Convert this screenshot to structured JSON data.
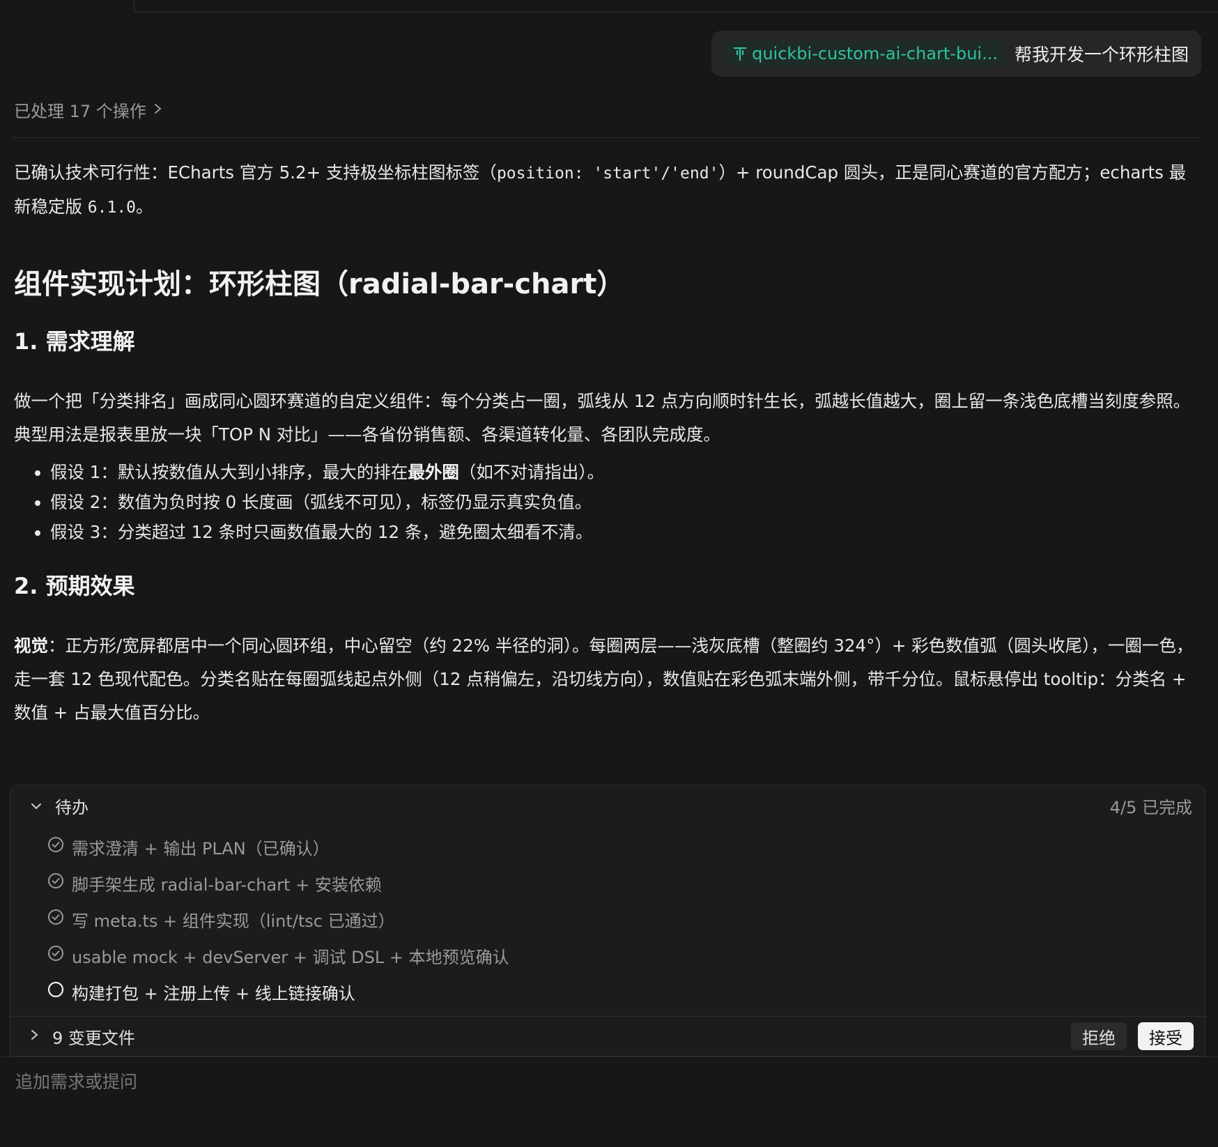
{
  "user_message": {
    "skill_chip": "quickbi-custom-ai-chart-bui...",
    "text": "帮我开发一个环形柱图"
  },
  "processed": {
    "label": "已处理 17 个操作"
  },
  "intro": {
    "part1": "已确认技术可行性：ECharts 官方 5.2+ 支持极坐标柱图标签（",
    "code1": "position: 'start'/'end'",
    "part2": "）+ roundCap 圆头，正是同心赛道的官方配方；echarts 最新稳定版 ",
    "code2": "6.1.0",
    "part3": "。"
  },
  "plan": {
    "title": "组件实现计划：环形柱图（radial-bar-chart）",
    "section1": {
      "heading": "1. 需求理解",
      "paragraph": "做一个把「分类排名」画成同心圆环赛道的自定义组件：每个分类占一圈，弧线从 12 点方向顺时针生长，弧越长值越大，圈上留一条浅色底槽当刻度参照。典型用法是报表里放一块「TOP N 对比」——各省份销售额、各渠道转化量、各团队完成度。",
      "bullets": [
        {
          "before": "假设 1：默认按数值从大到小排序，最大的排在",
          "bold": "最外圈",
          "after": "（如不对请指出）。"
        },
        {
          "before": "假设 2：数值为负时按 0 长度画（弧线不可见），标签仍显示真实负值。",
          "bold": "",
          "after": ""
        },
        {
          "before": "假设 3：分类超过 12 条时只画数值最大的 12 条，避免圈太细看不清。",
          "bold": "",
          "after": ""
        }
      ]
    },
    "section2": {
      "heading": "2. 预期效果",
      "bold_label": "视觉",
      "paragraph": "：正方形/宽屏都居中一个同心圆环组，中心留空（约 22% 半径的洞）。每圈两层——浅灰底槽（整圈约 324°）+ 彩色数值弧（圆头收尾），一圈一色，走一套 12 色现代配色。分类名贴在每圈弧线起点外侧（12 点稍偏左，沿切线方向），数值贴在彩色弧末端外侧，带千分位。鼠标悬停出 tooltip：分类名 + 数值 + 占最大值百分比。"
    }
  },
  "todo": {
    "label": "待办",
    "progress": "4/5 已完成",
    "items": [
      {
        "text": "需求澄清 + 输出 PLAN（已确认）",
        "done": true
      },
      {
        "text": "脚手架生成 radial-bar-chart + 安装依赖",
        "done": true
      },
      {
        "text": "写 meta.ts + 组件实现（lint/tsc 已通过）",
        "done": true
      },
      {
        "text": "usable mock + devServer + 调试 DSL + 本地预览确认",
        "done": true
      },
      {
        "text": "构建打包 + 注册上传 + 线上链接确认",
        "done": false
      }
    ],
    "files_label": "9 变更文件",
    "reject_label": "拒绝",
    "accept_label": "接受"
  },
  "composer": {
    "placeholder": "追加需求或提问"
  },
  "colors": {
    "accent": "#2fc3a0",
    "background": "#171717"
  }
}
